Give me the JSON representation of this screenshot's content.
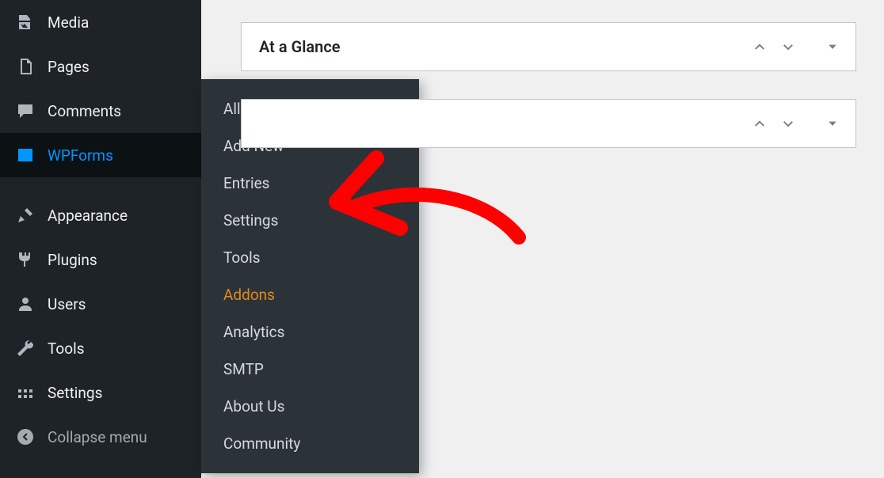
{
  "sidebar": {
    "items": [
      {
        "label": "Media"
      },
      {
        "label": "Pages"
      },
      {
        "label": "Comments"
      },
      {
        "label": "WPForms"
      },
      {
        "label": "Appearance"
      },
      {
        "label": "Plugins"
      },
      {
        "label": "Users"
      },
      {
        "label": "Tools"
      },
      {
        "label": "Settings"
      },
      {
        "label": "Collapse menu"
      }
    ]
  },
  "submenu": {
    "items": [
      {
        "label": "All Forms"
      },
      {
        "label": "Add New"
      },
      {
        "label": "Entries"
      },
      {
        "label": "Settings"
      },
      {
        "label": "Tools"
      },
      {
        "label": "Addons"
      },
      {
        "label": "Analytics"
      },
      {
        "label": "SMTP"
      },
      {
        "label": "About Us"
      },
      {
        "label": "Community"
      }
    ]
  },
  "panels": [
    {
      "title": "At a Glance"
    },
    {
      "title": ""
    }
  ]
}
